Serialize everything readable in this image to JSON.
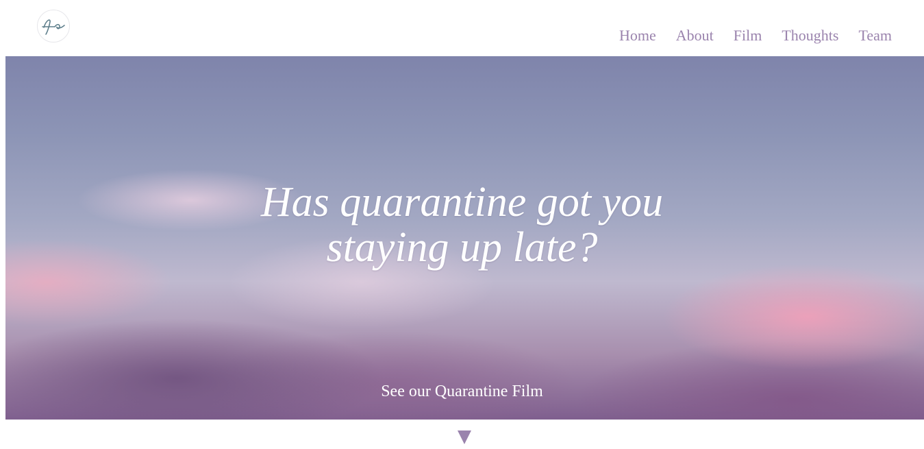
{
  "brand": {
    "logo_icon": "signature-logo-icon",
    "accent_color": "#9a83ad"
  },
  "nav": {
    "items": [
      {
        "label": "Home"
      },
      {
        "label": "About"
      },
      {
        "label": "Film"
      },
      {
        "label": "Thoughts"
      },
      {
        "label": "Team"
      }
    ]
  },
  "hero": {
    "title_line1": "Has quarantine got you",
    "title_line2": "staying up late?",
    "cta_label": "See our Quarantine Film",
    "scroll_icon": "triangle-down-icon"
  }
}
